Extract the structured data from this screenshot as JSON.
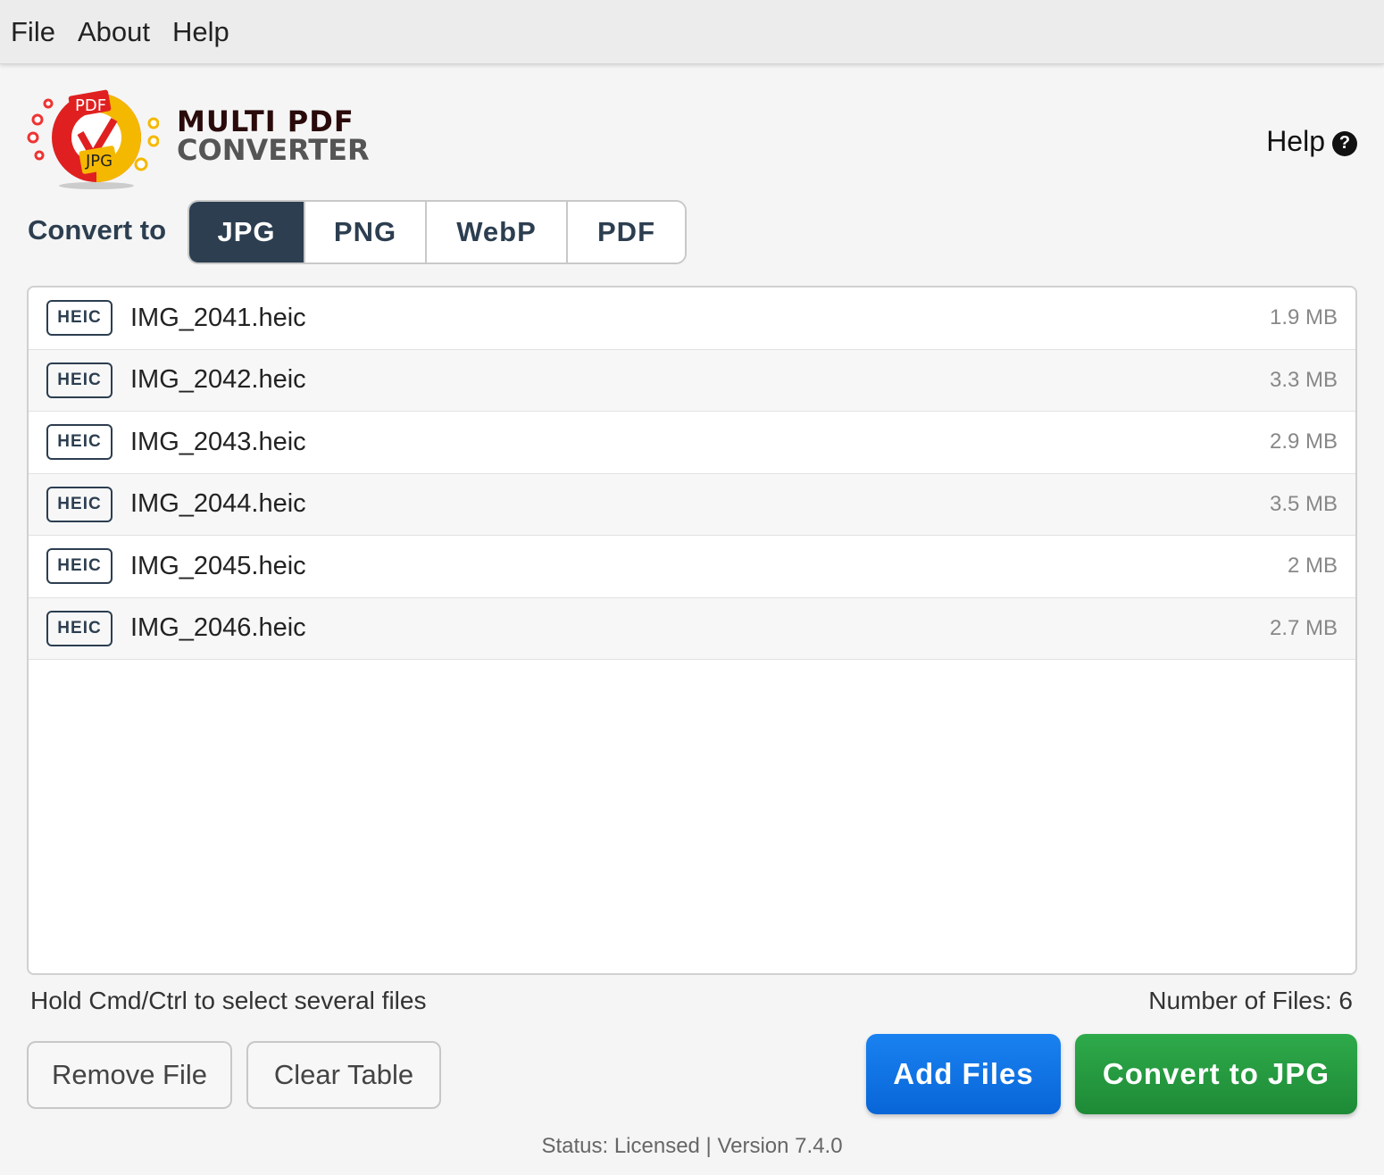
{
  "menu": [
    "File",
    "About",
    "Help"
  ],
  "brand": {
    "line1": "MULTI PDF",
    "line2": "CONVERTER",
    "logo_tag1": "PDF",
    "logo_tag2": "JPG"
  },
  "help_link": {
    "label": "Help",
    "icon": "question-circle-icon",
    "icon_glyph": "?"
  },
  "convert": {
    "label": "Convert to",
    "options": [
      "JPG",
      "PNG",
      "WebP",
      "PDF"
    ],
    "selected": "JPG"
  },
  "files": [
    {
      "type": "HEIC",
      "name": "IMG_2041.heic",
      "size": "1.9 MB"
    },
    {
      "type": "HEIC",
      "name": "IMG_2042.heic",
      "size": "3.3 MB"
    },
    {
      "type": "HEIC",
      "name": "IMG_2043.heic",
      "size": "2.9 MB"
    },
    {
      "type": "HEIC",
      "name": "IMG_2044.heic",
      "size": "3.5 MB"
    },
    {
      "type": "HEIC",
      "name": "IMG_2045.heic",
      "size": "2 MB"
    },
    {
      "type": "HEIC",
      "name": "IMG_2046.heic",
      "size": "2.7 MB"
    }
  ],
  "hint": "Hold Cmd/Ctrl to select several files",
  "count_label": "Number of Files: 6",
  "buttons": {
    "remove": "Remove File",
    "clear": "Clear Table",
    "add": "Add Files",
    "convert": "Convert to JPG"
  },
  "status": "Status: Licensed | Version 7.4.0",
  "colors": {
    "accent_dark": "#2c3e50",
    "add_blue": "#0a6fe0",
    "convert_green": "#23963f"
  }
}
